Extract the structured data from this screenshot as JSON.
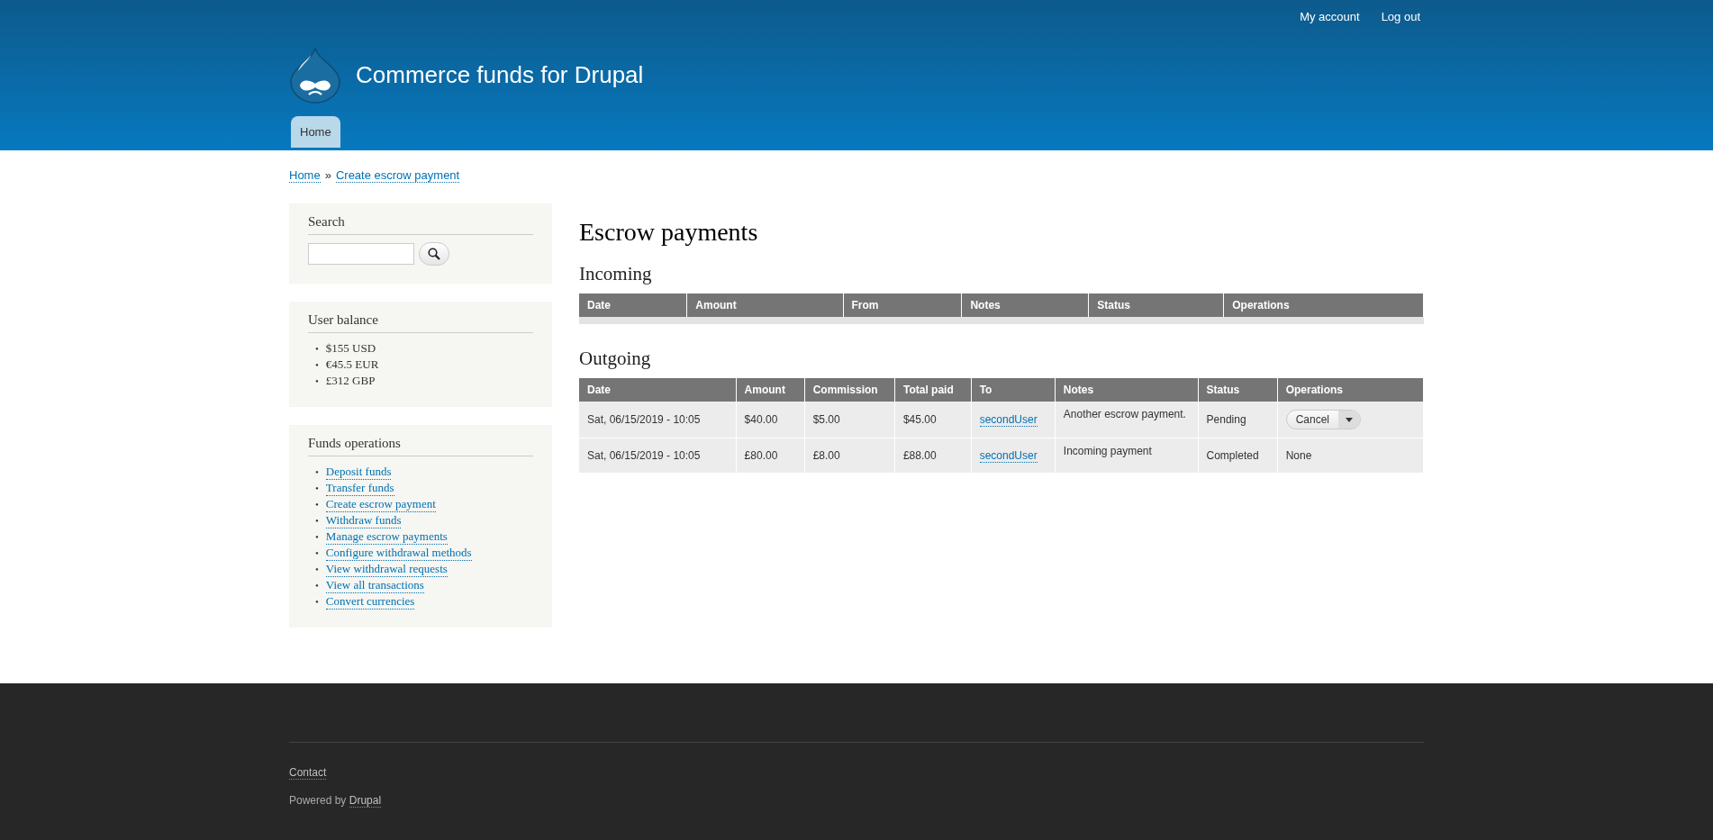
{
  "user_menu": [
    "My account",
    "Log out"
  ],
  "site_name": "Commerce funds for Drupal",
  "main_menu": [
    {
      "label": "Home",
      "selected": true
    }
  ],
  "breadcrumb": {
    "links": [
      "Home",
      "Create escrow payment"
    ],
    "separator": "»"
  },
  "sidebar": {
    "search": {
      "title": "Search"
    },
    "balance": {
      "title": "User balance",
      "bullet": "•",
      "items": [
        "$155 USD",
        "€45.5 EUR",
        "£312 GBP"
      ]
    },
    "operations": {
      "title": "Funds operations",
      "bullet": "•",
      "links": [
        "Deposit funds",
        "Transfer funds",
        "Create escrow payment",
        "Withdraw funds",
        "Manage escrow payments",
        "Configure withdrawal methods",
        "View withdrawal requests",
        "View all transactions",
        "Convert currencies"
      ]
    }
  },
  "page_title": "Escrow payments",
  "incoming": {
    "title": "Incoming",
    "columns": [
      "Date",
      "Amount",
      "From",
      "Notes",
      "Status",
      "Operations"
    ]
  },
  "outgoing": {
    "title": "Outgoing",
    "columns": [
      "Date",
      "Amount",
      "Commission",
      "Total paid",
      "To",
      "Notes",
      "Status",
      "Operations"
    ],
    "rows": [
      {
        "date": "Sat, 06/15/2019 - 10:05",
        "amount": "$40.00",
        "commission": "$5.00",
        "total": "$45.00",
        "to": "secondUser",
        "notes": "Another escrow payment.",
        "status": "Pending",
        "operations": {
          "kind": "dropbutton",
          "label": "Cancel"
        }
      },
      {
        "date": "Sat, 06/15/2019 - 10:05",
        "amount": "£80.00",
        "commission": "£8.00",
        "total": "£88.00",
        "to": "secondUser",
        "notes": "Incoming payment",
        "status": "Completed",
        "operations": {
          "kind": "text",
          "label": "None"
        }
      }
    ]
  },
  "footer": {
    "links": [
      "Contact"
    ],
    "powered_by": "Powered by",
    "powered_link": "Drupal"
  }
}
